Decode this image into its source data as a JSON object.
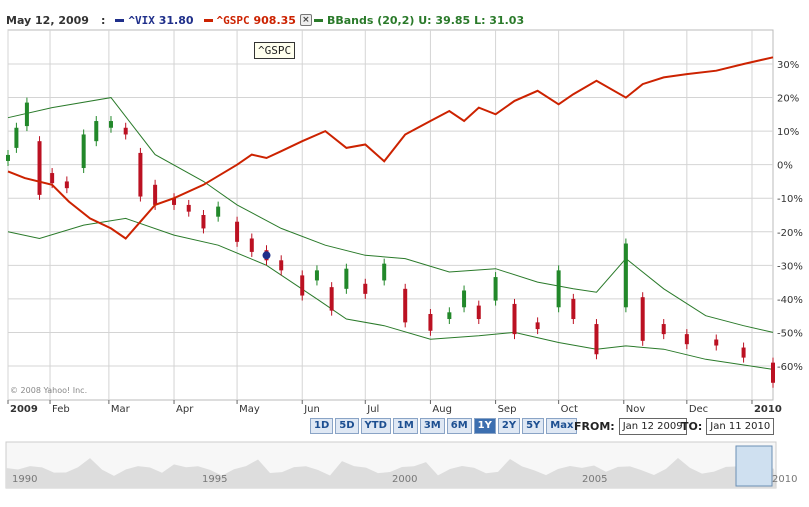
{
  "legend": {
    "date": "May 12, 2009",
    "separator": ":",
    "vix_symbol": "^VIX",
    "vix_value": "31.80",
    "gspc_symbol": "^GSPC",
    "gspc_value": "908.35",
    "bbands_label": "BBands (20,2)",
    "bbands_upper": "U: 39.85",
    "bbands_lower": "L: 31.03",
    "close_glyph": "×"
  },
  "tooltip": "^GSPC",
  "copyright": "© 2008 Yahoo! Inc.",
  "range_buttons": [
    "1D",
    "5D",
    "YTD",
    "1M",
    "3M",
    "6M",
    "1Y",
    "2Y",
    "5Y",
    "Max"
  ],
  "active_range": "1Y",
  "from_label": "FROM:",
  "from_value": "Jan 12 2009",
  "to_label": "TO:",
  "to_value": "Jan 11 2010",
  "colors": {
    "vix": "#1f2f8a",
    "gspc": "#cc2200",
    "bbands": "#2a7a2a",
    "candle_up": "#22882a",
    "candle_down": "#bb1122",
    "grid": "#d4d4d4"
  },
  "chart_data": {
    "type": "line",
    "x_tick_labels": [
      "2009",
      "Feb",
      "Mar",
      "Apr",
      "May",
      "Jun",
      "Jul",
      "Aug",
      "Sep",
      "Oct",
      "Nov",
      "Dec",
      "2010"
    ],
    "y_tick_labels": [
      "30%",
      "20%",
      "10%",
      "0%",
      "-10%",
      "-20%",
      "-30%",
      "-40%",
      "-50%",
      "-60%"
    ],
    "ylim": [
      -66,
      32
    ],
    "xlim": [
      "2009-01-12",
      "2010-01-11"
    ],
    "grid": true,
    "series": [
      {
        "name": "^GSPC",
        "kind": "line",
        "points": [
          [
            "2009-01-12",
            -2
          ],
          [
            "2009-01-20",
            -4
          ],
          [
            "2009-02-02",
            -6
          ],
          [
            "2009-02-10",
            -11
          ],
          [
            "2009-02-20",
            -16
          ],
          [
            "2009-03-02",
            -19
          ],
          [
            "2009-03-09",
            -22
          ],
          [
            "2009-03-16",
            -17
          ],
          [
            "2009-03-23",
            -12
          ],
          [
            "2009-04-01",
            -10
          ],
          [
            "2009-04-15",
            -6
          ],
          [
            "2009-05-01",
            0
          ],
          [
            "2009-05-08",
            3
          ],
          [
            "2009-05-15",
            2
          ],
          [
            "2009-05-22",
            4
          ],
          [
            "2009-06-01",
            7
          ],
          [
            "2009-06-12",
            10
          ],
          [
            "2009-06-22",
            5
          ],
          [
            "2009-07-01",
            6
          ],
          [
            "2009-07-10",
            1
          ],
          [
            "2009-07-20",
            9
          ],
          [
            "2009-08-01",
            13
          ],
          [
            "2009-08-10",
            16
          ],
          [
            "2009-08-17",
            13
          ],
          [
            "2009-08-24",
            17
          ],
          [
            "2009-09-01",
            15
          ],
          [
            "2009-09-10",
            19
          ],
          [
            "2009-09-21",
            22
          ],
          [
            "2009-10-01",
            18
          ],
          [
            "2009-10-08",
            21
          ],
          [
            "2009-10-19",
            25
          ],
          [
            "2009-11-02",
            20
          ],
          [
            "2009-11-10",
            24
          ],
          [
            "2009-11-20",
            26
          ],
          [
            "2009-12-01",
            27
          ],
          [
            "2009-12-15",
            28
          ],
          [
            "2009-12-28",
            30
          ],
          [
            "2010-01-11",
            32
          ]
        ]
      },
      {
        "name": "^VIX",
        "kind": "candlestick",
        "points": [
          [
            "2009-01-12",
            2
          ],
          [
            "2009-01-16",
            8
          ],
          [
            "2009-01-21",
            15
          ],
          [
            "2009-01-27",
            -1
          ],
          [
            "2009-02-02",
            -4
          ],
          [
            "2009-02-09",
            -6
          ],
          [
            "2009-02-17",
            4
          ],
          [
            "2009-02-23",
            10
          ],
          [
            "2009-03-02",
            12
          ],
          [
            "2009-03-09",
            10
          ],
          [
            "2009-03-16",
            -3
          ],
          [
            "2009-03-23",
            -9
          ],
          [
            "2009-04-01",
            -11
          ],
          [
            "2009-04-08",
            -13
          ],
          [
            "2009-04-15",
            -17
          ],
          [
            "2009-04-22",
            -14
          ],
          [
            "2009-05-01",
            -20
          ],
          [
            "2009-05-08",
            -24
          ],
          [
            "2009-05-15",
            -27
          ],
          [
            "2009-05-22",
            -30
          ],
          [
            "2009-06-01",
            -36
          ],
          [
            "2009-06-08",
            -33
          ],
          [
            "2009-06-15",
            -40
          ],
          [
            "2009-06-22",
            -34
          ],
          [
            "2009-07-01",
            -37
          ],
          [
            "2009-07-10",
            -32
          ],
          [
            "2009-07-20",
            -42
          ],
          [
            "2009-08-01",
            -47
          ],
          [
            "2009-08-10",
            -45
          ],
          [
            "2009-08-17",
            -40
          ],
          [
            "2009-08-24",
            -44
          ],
          [
            "2009-09-01",
            -37
          ],
          [
            "2009-09-10",
            -46
          ],
          [
            "2009-09-21",
            -48
          ],
          [
            "2009-10-01",
            -37
          ],
          [
            "2009-10-08",
            -43
          ],
          [
            "2009-10-19",
            -52
          ],
          [
            "2009-11-02",
            -33
          ],
          [
            "2009-11-10",
            -46
          ],
          [
            "2009-11-20",
            -49
          ],
          [
            "2009-12-01",
            -52
          ],
          [
            "2009-12-15",
            -53
          ],
          [
            "2009-12-28",
            -56
          ],
          [
            "2010-01-11",
            -62
          ]
        ]
      },
      {
        "name": "BBands (20,2) Upper",
        "kind": "line",
        "points": [
          [
            "2009-01-12",
            14
          ],
          [
            "2009-02-02",
            17
          ],
          [
            "2009-03-02",
            20
          ],
          [
            "2009-03-23",
            3
          ],
          [
            "2009-04-15",
            -5
          ],
          [
            "2009-05-01",
            -12
          ],
          [
            "2009-05-22",
            -19
          ],
          [
            "2009-06-12",
            -24
          ],
          [
            "2009-07-01",
            -27
          ],
          [
            "2009-07-20",
            -28
          ],
          [
            "2009-08-10",
            -32
          ],
          [
            "2009-09-01",
            -31
          ],
          [
            "2009-09-21",
            -35
          ],
          [
            "2009-10-08",
            -37
          ],
          [
            "2009-10-19",
            -38
          ],
          [
            "2009-11-02",
            -28
          ],
          [
            "2009-11-20",
            -37
          ],
          [
            "2009-12-10",
            -45
          ],
          [
            "2009-12-28",
            -48
          ],
          [
            "2010-01-11",
            -50
          ]
        ]
      },
      {
        "name": "BBands (20,2) Lower",
        "kind": "line",
        "points": [
          [
            "2009-01-12",
            -20
          ],
          [
            "2009-01-27",
            -22
          ],
          [
            "2009-02-17",
            -18
          ],
          [
            "2009-03-09",
            -16
          ],
          [
            "2009-04-01",
            -21
          ],
          [
            "2009-04-22",
            -24
          ],
          [
            "2009-05-15",
            -30
          ],
          [
            "2009-06-08",
            -40
          ],
          [
            "2009-06-22",
            -46
          ],
          [
            "2009-07-10",
            -48
          ],
          [
            "2009-08-01",
            -52
          ],
          [
            "2009-08-24",
            -51
          ],
          [
            "2009-09-10",
            -50
          ],
          [
            "2009-10-01",
            -53
          ],
          [
            "2009-10-19",
            -55
          ],
          [
            "2009-11-02",
            -54
          ],
          [
            "2009-11-20",
            -55
          ],
          [
            "2009-12-10",
            -58
          ],
          [
            "2010-01-11",
            -61
          ]
        ]
      }
    ],
    "overview_labels": [
      "1990",
      "1995",
      "2000",
      "2005",
      "2010"
    ]
  }
}
